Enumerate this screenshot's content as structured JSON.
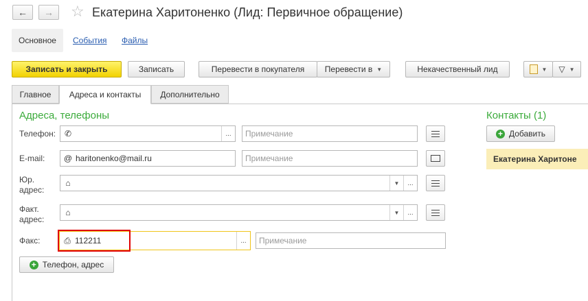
{
  "window": {
    "title": "Екатерина Харитоненко (Лид: Первичное обращение)"
  },
  "sections": [
    {
      "label": "Основное"
    },
    {
      "label": "События"
    },
    {
      "label": "Файлы"
    }
  ],
  "toolbar": {
    "save_close": "Записать и закрыть",
    "save": "Записать",
    "to_customer": "Перевести в покупателя",
    "move_to": "Перевести в",
    "bad_lead": "Некачественный лид"
  },
  "tabs": [
    {
      "label": "Главное"
    },
    {
      "label": "Адреса и контакты"
    },
    {
      "label": "Дополнительно"
    }
  ],
  "addresses": {
    "group_title": "Адреса, телефоны",
    "phone_label": "Телефон:",
    "phone_value": "",
    "phone_note_placeholder": "Примечание",
    "email_label": "E-mail:",
    "email_value": "haritonenko@mail.ru",
    "email_note_placeholder": "Примечание",
    "legal_label_1": "Юр.",
    "legal_label_2": "адрес:",
    "actual_label_1": "Факт.",
    "actual_label_2": "адрес:",
    "fax_label": "Факс:",
    "fax_value": "112211",
    "fax_note_placeholder": "Примечание",
    "add_phone_button": "Телефон, адрес"
  },
  "contacts": {
    "group_title": "Контакты (1)",
    "add_button": "Добавить",
    "items": [
      {
        "name": "Екатерина Харитоне"
      }
    ]
  },
  "icons": {
    "back": "arrow-left-icon",
    "forward": "arrow-right-icon",
    "favorite": "star-icon",
    "phone": "phone-icon",
    "email": "at-icon",
    "address": "house-icon",
    "fax": "fax-icon",
    "menu": "lines-menu-icon",
    "envelope": "envelope-icon"
  },
  "colors": {
    "accent_green": "#3bab3b",
    "primary_yellow": "#f2d200",
    "highlight_red": "#e00000",
    "contact_card": "#fbeeb8",
    "link_blue": "#2a5db0"
  }
}
